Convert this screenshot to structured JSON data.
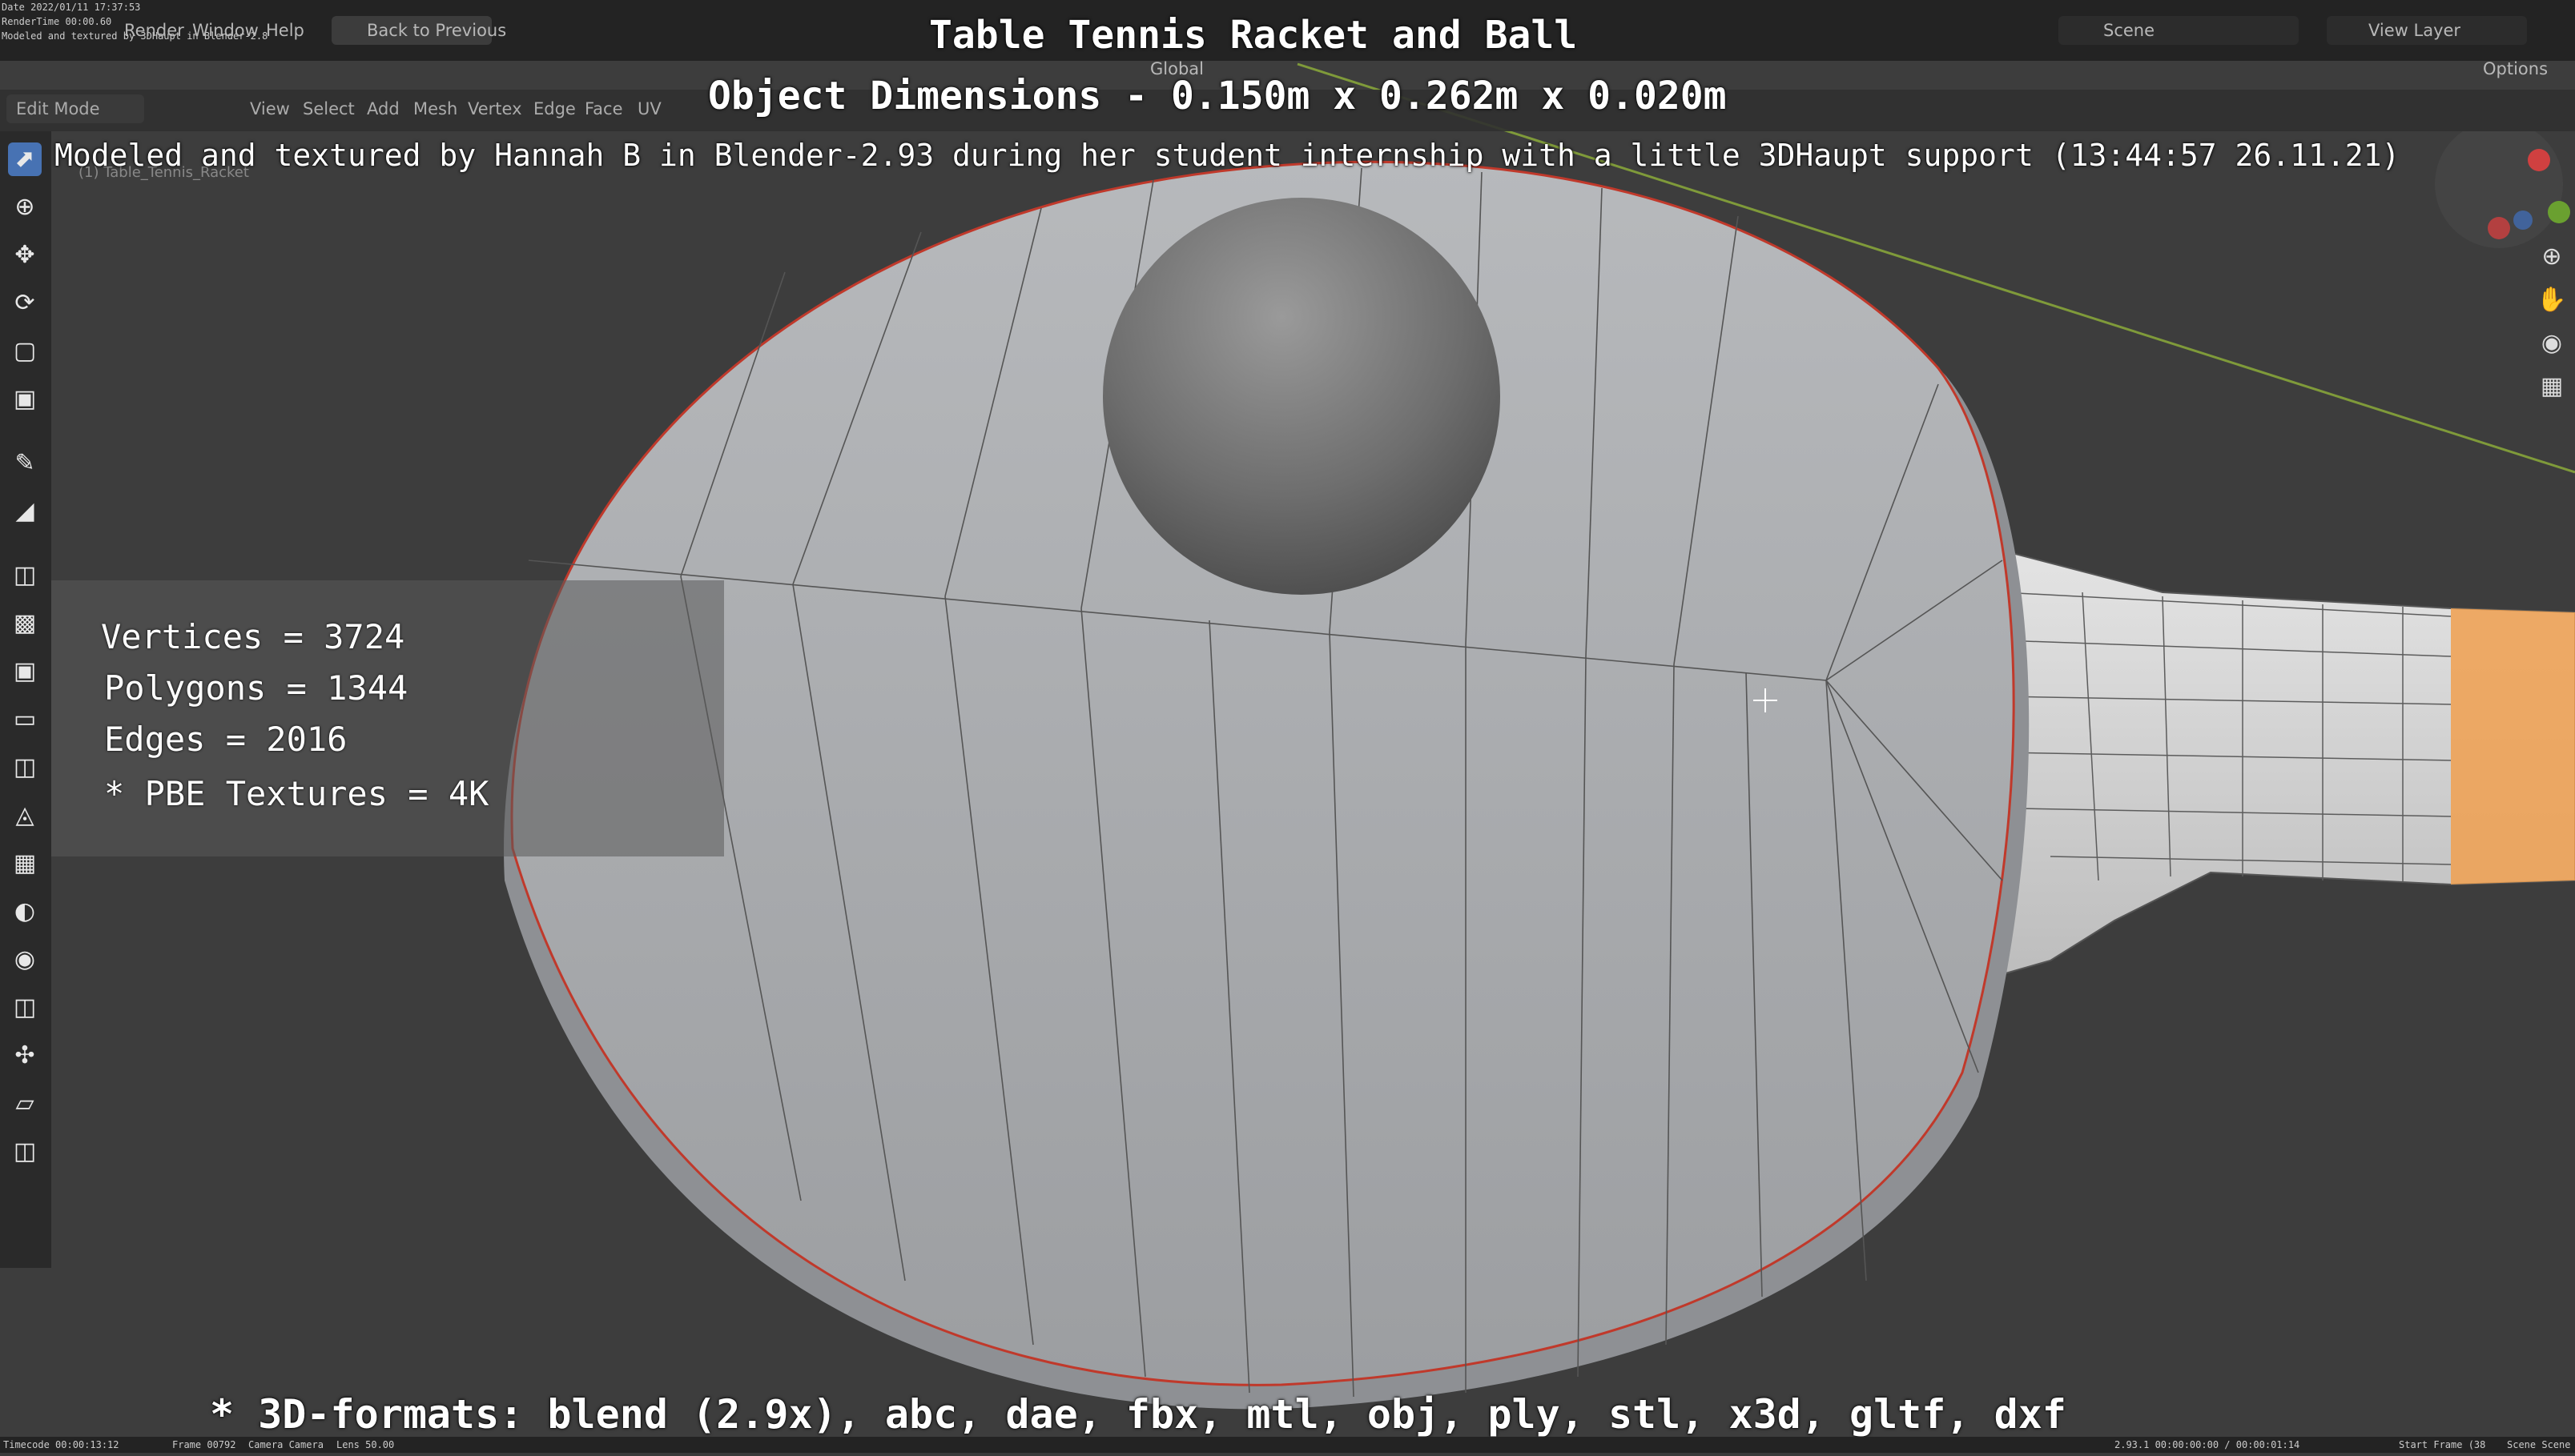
{
  "meta": {
    "date": "Date 2022/01/11 17:37:53",
    "render_time": "RenderTime 00:00.60",
    "note": "Modeled and textured by 3DHaupt in Blender-2.8"
  },
  "menu": {
    "render": "Render",
    "window": "Window",
    "help": "Help",
    "back_to_previous": "Back to Previous"
  },
  "scene": {
    "scene_name": "Scene",
    "view_layer": "View Layer",
    "options": "Options"
  },
  "header": {
    "mode": "Edit Mode",
    "view": "View",
    "select": "Select",
    "add": "Add",
    "mesh": "Mesh",
    "vertex": "Vertex",
    "edge": "Edge",
    "face": "Face",
    "uv": "UV",
    "orientation": "Global",
    "object_name": "(1) Table_Tennis_Racket"
  },
  "overlay": {
    "title": "Table Tennis Racket and Ball",
    "dimensions": "Object Dimensions -  0.150m x 0.262m x 0.020m",
    "credit": "Modeled and textured by Hannah B in Blender-2.93 during her student internship with a little 3DHaupt support (13:44:57 26.11.21)",
    "formats": "* 3D-formats: blend (2.9x), abc, dae, fbx, mtl, obj, ply, stl, x3d, gltf, dxf"
  },
  "stats": {
    "vertices": "Vertices = 3724",
    "polygons": "Polygons = 1344",
    "edges": "Edges = 2016",
    "textures": "* PBE Textures = 4K"
  },
  "status": {
    "timecode": "Timecode 00:00:13:12",
    "frame": "Frame 00792",
    "camera": "Camera Camera",
    "lens": "Lens 50.00",
    "version_time": "2.93.1  00:00:00:00 / 00:00:01:14",
    "start_frame": "Start Frame (38",
    "scene": "Scene Scene"
  },
  "colors": {
    "accent": "#4772b3",
    "racket": "#a9abae",
    "handle": "#d8d8d8",
    "selection": "#f0a050",
    "rubber_edge": "#c0392b",
    "ball": "#7c7c7c"
  }
}
